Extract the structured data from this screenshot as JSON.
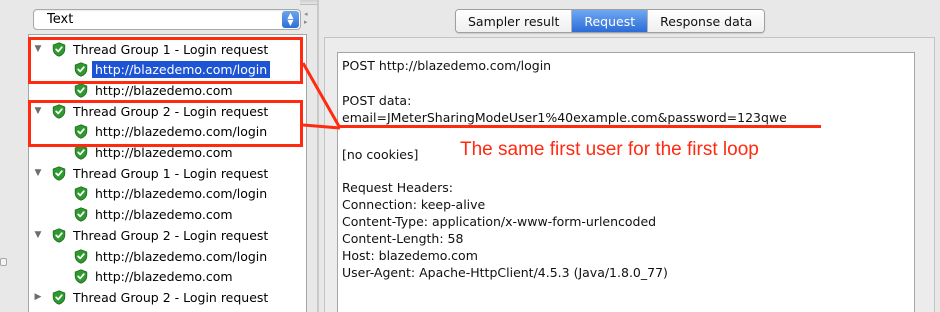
{
  "left": {
    "renderer_select": {
      "value": "Text"
    },
    "tree": [
      {
        "label": "Thread Group 1 - Login request",
        "type": "group",
        "expanded": true
      },
      {
        "label": "http://blazedemo.com/login",
        "type": "sample",
        "selected": true
      },
      {
        "label": "http://blazedemo.com",
        "type": "sample"
      },
      {
        "label": "Thread Group 2 - Login request",
        "type": "group",
        "expanded": true
      },
      {
        "label": "http://blazedemo.com/login",
        "type": "sample"
      },
      {
        "label": "http://blazedemo.com",
        "type": "sample"
      },
      {
        "label": "Thread Group 1 - Login request",
        "type": "group",
        "expanded": true
      },
      {
        "label": "http://blazedemo.com/login",
        "type": "sample"
      },
      {
        "label": "http://blazedemo.com",
        "type": "sample"
      },
      {
        "label": "Thread Group 2 - Login request",
        "type": "group",
        "expanded": true
      },
      {
        "label": "http://blazedemo.com/login",
        "type": "sample"
      },
      {
        "label": "http://blazedemo.com",
        "type": "sample"
      },
      {
        "label": "Thread Group 2 - Login request",
        "type": "group",
        "expanded": false
      }
    ]
  },
  "right": {
    "tabs": [
      {
        "label": "Sampler result",
        "active": false
      },
      {
        "label": "Request",
        "active": true
      },
      {
        "label": "Response data",
        "active": false
      }
    ],
    "request_text": {
      "line_post": "POST http://blazedemo.com/login",
      "line_post_data_label": "POST data:",
      "line_post_data": "email=JMeterSharingModeUser1%40example.com&password=123qwe",
      "line_cookies": "[no cookies]",
      "line_headers_label": "Request Headers:",
      "header_connection": "Connection: keep-alive",
      "header_content_type": "Content-Type: application/x-www-form-urlencoded",
      "header_content_length": "Content-Length: 58",
      "header_host": "Host: blazedemo.com",
      "header_user_agent": "User-Agent: Apache-HttpClient/4.5.3 (Java/1.8.0_77)"
    }
  },
  "annotation": {
    "caption": "The same first user for the first loop",
    "color": "#ff2a10"
  },
  "colors": {
    "selection_bg": "#1d54d4",
    "tab_active": "#2c6cd7",
    "shield_green": "#2e9a2e"
  }
}
